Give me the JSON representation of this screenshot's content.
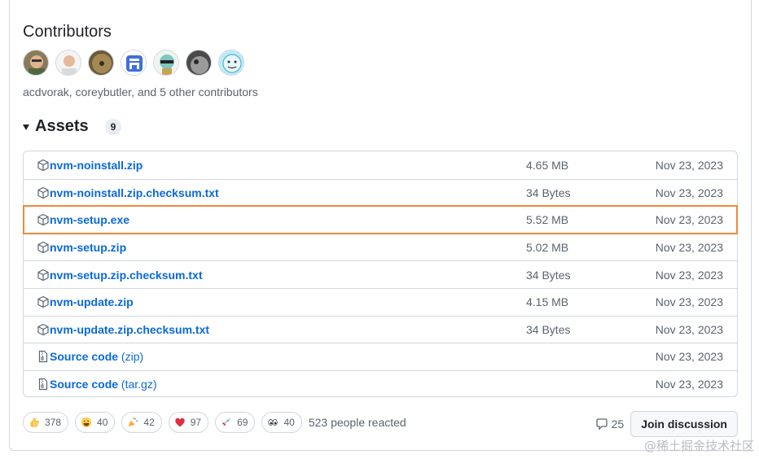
{
  "contributors": {
    "title": "Contributors",
    "summary": "acdvorak, coreybutler, and 5 other contributors",
    "avatars": [
      "acdvorak",
      "coreybutler",
      "contributor-3",
      "contributor-4",
      "contributor-5",
      "contributor-6",
      "contributor-7"
    ]
  },
  "assets": {
    "title": "Assets",
    "count": "9",
    "rows": [
      {
        "name": "nvm-noinstall.zip",
        "suffix": "",
        "size": "4.65 MB",
        "date": "Nov 23, 2023",
        "icon": "package-icon",
        "highlight": false
      },
      {
        "name": "nvm-noinstall.zip.checksum.txt",
        "suffix": "",
        "size": "34 Bytes",
        "date": "Nov 23, 2023",
        "icon": "package-icon",
        "highlight": false
      },
      {
        "name": "nvm-setup.exe",
        "suffix": "",
        "size": "5.52 MB",
        "date": "Nov 23, 2023",
        "icon": "package-icon",
        "highlight": true
      },
      {
        "name": "nvm-setup.zip",
        "suffix": "",
        "size": "5.02 MB",
        "date": "Nov 23, 2023",
        "icon": "package-icon",
        "highlight": false
      },
      {
        "name": "nvm-setup.zip.checksum.txt",
        "suffix": "",
        "size": "34 Bytes",
        "date": "Nov 23, 2023",
        "icon": "package-icon",
        "highlight": false
      },
      {
        "name": "nvm-update.zip",
        "suffix": "",
        "size": "4.15 MB",
        "date": "Nov 23, 2023",
        "icon": "package-icon",
        "highlight": false
      },
      {
        "name": "nvm-update.zip.checksum.txt",
        "suffix": "",
        "size": "34 Bytes",
        "date": "Nov 23, 2023",
        "icon": "package-icon",
        "highlight": false
      },
      {
        "name": "Source code",
        "suffix": " (zip)",
        "size": "",
        "date": "Nov 23, 2023",
        "icon": "file-zip-icon",
        "highlight": false
      },
      {
        "name": "Source code",
        "suffix": " (tar.gz)",
        "size": "",
        "date": "Nov 23, 2023",
        "icon": "file-zip-icon",
        "highlight": false
      }
    ]
  },
  "reactions": {
    "items": [
      {
        "icon": "thumbs-up-icon",
        "count": "378"
      },
      {
        "icon": "laugh-icon",
        "count": "40"
      },
      {
        "icon": "hooray-icon",
        "count": "42"
      },
      {
        "icon": "heart-icon",
        "count": "97"
      },
      {
        "icon": "rocket-icon",
        "count": "69"
      },
      {
        "icon": "eyes-icon",
        "count": "40"
      }
    ],
    "summary": "523 people reacted"
  },
  "discussion": {
    "comment_count": "25",
    "join_label": "Join discussion"
  },
  "watermark": "@稀土掘金技术社区",
  "colors": {
    "link": "#0969da",
    "highlight_outline": "#f0883e",
    "border": "#d0d7de",
    "muted_text": "#59636e"
  }
}
